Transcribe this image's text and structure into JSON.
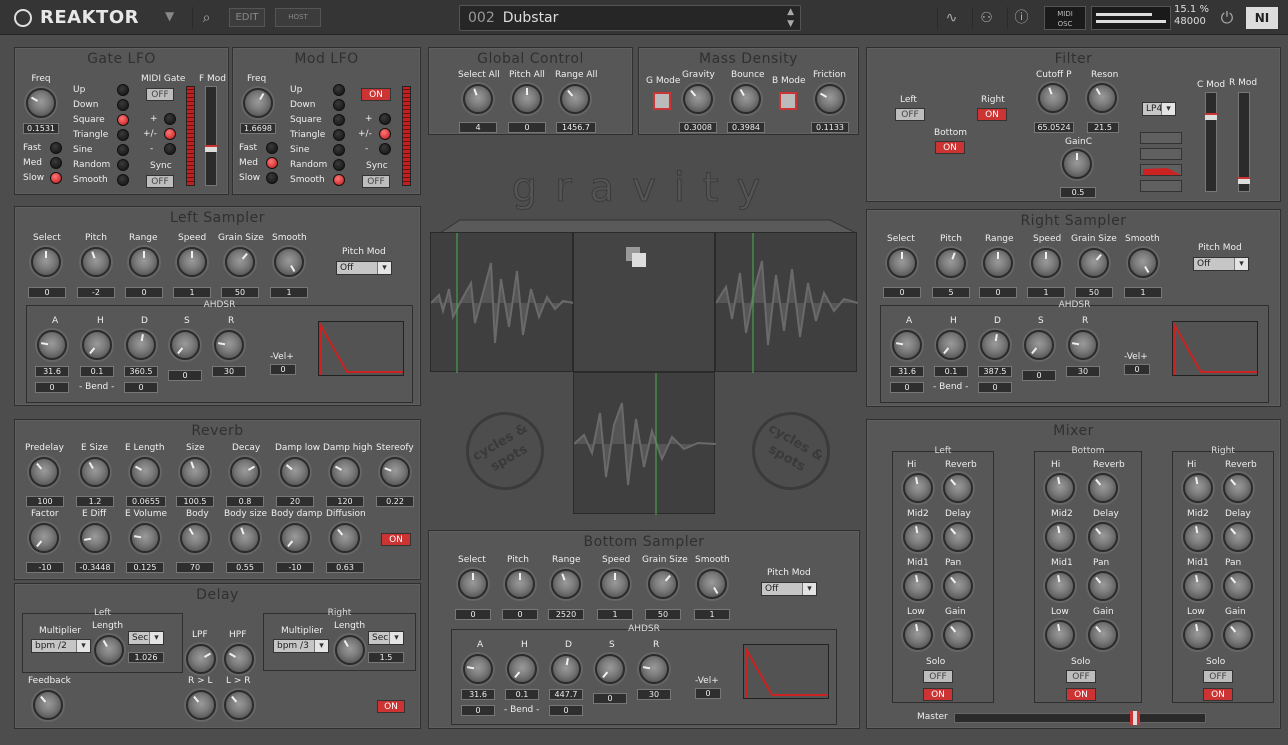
{
  "topbar": {
    "logo": "REAKTOR",
    "edit_label": "EDIT",
    "host_label": "HOST",
    "preset_number": "002",
    "preset_name": "Dubstar",
    "midi_label": "MIDI",
    "osc_label": "OSC",
    "cpu_percent": "15.1 %",
    "sample_rate": "48000",
    "ni_label": "NI"
  },
  "gate_lfo": {
    "title": "Gate LFO",
    "freq_label": "Freq",
    "freq_value": "0.1531",
    "midi_gate_label": "MIDI Gate",
    "midi_gate_state": "OFF",
    "fmod_label": "F Mod",
    "waves": [
      "Up",
      "Down",
      "Square",
      "Triangle",
      "Sine",
      "Random",
      "Smooth"
    ],
    "wave_selected": 2,
    "speeds": [
      "Fast",
      "Med",
      "Slow"
    ],
    "speed_selected": 2,
    "polarity": [
      "+",
      "+/-",
      "-"
    ],
    "polarity_selected": 1,
    "sync_label": "Sync",
    "sync_state": "OFF"
  },
  "mod_lfo": {
    "title": "Mod LFO",
    "freq_label": "Freq",
    "freq_value": "1.6698",
    "state": "ON",
    "fmod_label": "F Mod",
    "waves": [
      "Up",
      "Down",
      "Square",
      "Triangle",
      "Sine",
      "Random",
      "Smooth"
    ],
    "wave_selected": 6,
    "speeds": [
      "Fast",
      "Med",
      "Slow"
    ],
    "speed_selected": 1,
    "polarity": [
      "+",
      "+/-",
      "-"
    ],
    "polarity_selected": 1,
    "sync_label": "Sync",
    "sync_state": "OFF"
  },
  "global_control": {
    "title": "Global Control",
    "labels": [
      "Select All",
      "Pitch All",
      "Range All"
    ],
    "values": [
      "4",
      "0",
      "1456.7"
    ]
  },
  "mass_density": {
    "title": "Mass Density",
    "g_mode": "G Mode",
    "b_mode": "B Mode",
    "labels": [
      "Gravity",
      "Bounce",
      "Friction"
    ],
    "values": [
      "0.3008",
      "0.3984",
      "0.1133"
    ]
  },
  "filter": {
    "title": "Filter",
    "left_label": "Left",
    "left_state": "OFF",
    "right_label": "Right",
    "right_state": "ON",
    "bottom_label": "Bottom",
    "bottom_state": "ON",
    "cutoff_label": "Cutoff P",
    "cutoff_value": "65.0524",
    "reson_label": "Reson",
    "reson_value": "21.5",
    "gain_label": "GainC",
    "gain_value": "0.5",
    "type": "LP4",
    "cmod_label": "C Mod",
    "rmod_label": "R Mod"
  },
  "logo_text": "gravity",
  "badge_text": "cycles & spots",
  "left_sampler": {
    "title": "Left Sampler",
    "labels": [
      "Select",
      "Pitch",
      "Range",
      "Speed",
      "Grain Size",
      "Smooth"
    ],
    "values": [
      "0",
      "-2",
      "0",
      "1",
      "50",
      "1"
    ],
    "pitch_mod_label": "Pitch Mod",
    "pitch_mod": "Off",
    "ahdsr_title": "AHDSR",
    "env_labels": [
      "A",
      "H",
      "D",
      "S",
      "R"
    ],
    "env_values": [
      "31.6",
      "0.1",
      "360.5",
      "0",
      "30"
    ],
    "bend_label": "- Bend -",
    "bend_values": [
      "0",
      "0"
    ],
    "vel_label": "-Vel+",
    "vel_value": "0"
  },
  "right_sampler": {
    "title": "Right Sampler",
    "labels": [
      "Select",
      "Pitch",
      "Range",
      "Speed",
      "Grain Size",
      "Smooth"
    ],
    "values": [
      "0",
      "5",
      "0",
      "1",
      "50",
      "1"
    ],
    "pitch_mod_label": "Pitch Mod",
    "pitch_mod": "Off",
    "ahdsr_title": "AHDSR",
    "env_labels": [
      "A",
      "H",
      "D",
      "S",
      "R"
    ],
    "env_values": [
      "31.6",
      "0.1",
      "387.5",
      "0",
      "30"
    ],
    "bend_label": "- Bend -",
    "bend_values": [
      "0",
      "0"
    ],
    "vel_label": "-Vel+",
    "vel_value": "0"
  },
  "bottom_sampler": {
    "title": "Bottom Sampler",
    "labels": [
      "Select",
      "Pitch",
      "Range",
      "Speed",
      "Grain Size",
      "Smooth"
    ],
    "values": [
      "0",
      "0",
      "2520",
      "1",
      "50",
      "1"
    ],
    "pitch_mod_label": "Pitch Mod",
    "pitch_mod": "Off",
    "ahdsr_title": "AHDSR",
    "env_labels": [
      "A",
      "H",
      "D",
      "S",
      "R"
    ],
    "env_values": [
      "31.6",
      "0.1",
      "447.7",
      "0",
      "30"
    ],
    "bend_label": "- Bend -",
    "bend_values": [
      "0",
      "0"
    ],
    "vel_label": "-Vel+",
    "vel_value": "0"
  },
  "reverb": {
    "title": "Reverb",
    "row1_labels": [
      "Predelay",
      "E Size",
      "E Length",
      "Size",
      "Decay",
      "Damp low",
      "Damp high",
      "Stereofy"
    ],
    "row1_values": [
      "100",
      "1.2",
      "0.0655",
      "100.5",
      "0.8",
      "20",
      "120",
      "0.22"
    ],
    "row2_labels": [
      "Factor",
      "E Diff",
      "E Volume",
      "Body",
      "Body size",
      "Body damp",
      "Diffusion"
    ],
    "row2_values": [
      "-10",
      "-0.3448",
      "0.125",
      "70",
      "0.55",
      "-10",
      "0.63"
    ],
    "state": "ON"
  },
  "delay": {
    "title": "Delay",
    "left_title": "Left",
    "right_title": "Right",
    "multiplier_label": "Multiplier",
    "length_label": "Length",
    "left_mult": "bpm /2",
    "left_unit": "Sec",
    "left_length": "1.026",
    "right_mult": "bpm /3",
    "right_unit": "Sec",
    "right_length": "1.5",
    "lpf_label": "LPF",
    "hpf_label": "HPF",
    "rl_label": "R > L",
    "lr_label": "L > R",
    "feedback_label": "Feedback",
    "state": "ON"
  },
  "mixer": {
    "title": "Mixer",
    "channels": [
      {
        "name": "Left",
        "solo": "OFF",
        "on": "ON"
      },
      {
        "name": "Bottom",
        "solo": "OFF",
        "on": "ON"
      },
      {
        "name": "Right",
        "solo": "OFF",
        "on": "ON"
      }
    ],
    "left_col": [
      "Hi",
      "Mid2",
      "Mid1",
      "Low"
    ],
    "right_col": [
      "Reverb",
      "Delay",
      "Pan",
      "Gain"
    ],
    "solo_label": "Solo",
    "master_label": "Master",
    "master_level": 0.73
  }
}
